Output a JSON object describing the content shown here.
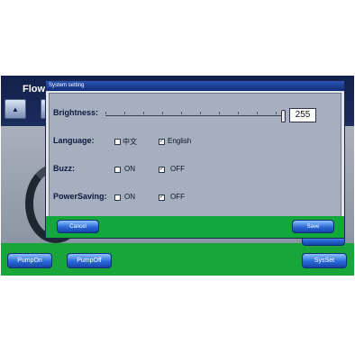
{
  "screen": {
    "flow_label": "Flow:",
    "buttons": {
      "pump_on": "PumpOn",
      "pump_off": "PumpOff",
      "sys_set": "SysSet"
    }
  },
  "dialog": {
    "title": "System setting",
    "brightness": {
      "label": "Brightness:",
      "value": "255",
      "level_percent": 100
    },
    "language": {
      "label": "Language:",
      "options": [
        {
          "label": "中文",
          "checked": false
        },
        {
          "label": "English",
          "checked": true
        }
      ]
    },
    "buzz": {
      "label": "Buzz:",
      "options": [
        {
          "label": "ON",
          "checked": false
        },
        {
          "label": "OFF",
          "checked": true
        }
      ]
    },
    "power_saving": {
      "label": "PowerSaving:",
      "options": [
        {
          "label": "ON",
          "checked": false
        },
        {
          "label": "OFF",
          "checked": true
        }
      ]
    },
    "cancel_label": "Cancel",
    "save_label": "Save"
  },
  "colors": {
    "dialog_title_bar": "#1d3f9a",
    "footer_green": "#12a83b",
    "button_blue": "#2a67d8",
    "screen_navy": "#14224e"
  }
}
